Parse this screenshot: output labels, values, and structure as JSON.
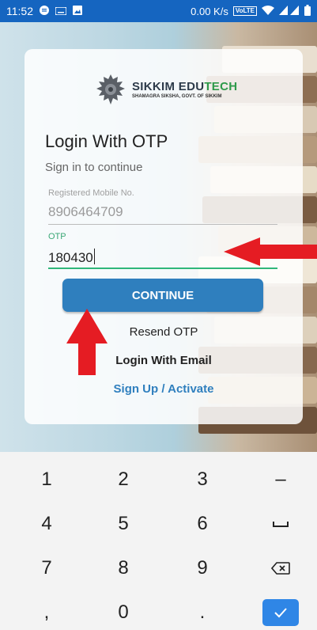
{
  "status_bar": {
    "time": "11:52",
    "speed": "0.00 K/s",
    "volte": "VoLTE",
    "icons": [
      "notification-icon",
      "keyboard-icon",
      "image-icon",
      "wifi-icon",
      "signal-icon",
      "battery-icon"
    ]
  },
  "brand": {
    "name_part1": "SIKKIM EDU",
    "name_part2": "TECH",
    "tagline": "SHAMAGRA SIKSHA, GOVT. OF SIKKIM",
    "accent_color": "#2e9a4a"
  },
  "form": {
    "title": "Login With OTP",
    "subtitle": "Sign in to continue",
    "mobile_label": "Registered Mobile No.",
    "mobile_value": "8906464709",
    "otp_label": "OTP",
    "otp_value": "180430",
    "continue_label": "CONTINUE",
    "resend_label": "Resend OTP",
    "login_email_label": "Login With Email",
    "signup_label": "Sign Up / Activate",
    "primary_color": "#2f7fbe"
  },
  "annotations": {
    "arrow_color": "#e51c23"
  },
  "keyboard": {
    "keys": [
      [
        "1",
        "2",
        "3",
        "–"
      ],
      [
        "4",
        "5",
        "6",
        "␣"
      ],
      [
        "7",
        "8",
        "9",
        "⌫"
      ],
      [
        ",",
        "0",
        ".",
        "✓"
      ]
    ]
  }
}
